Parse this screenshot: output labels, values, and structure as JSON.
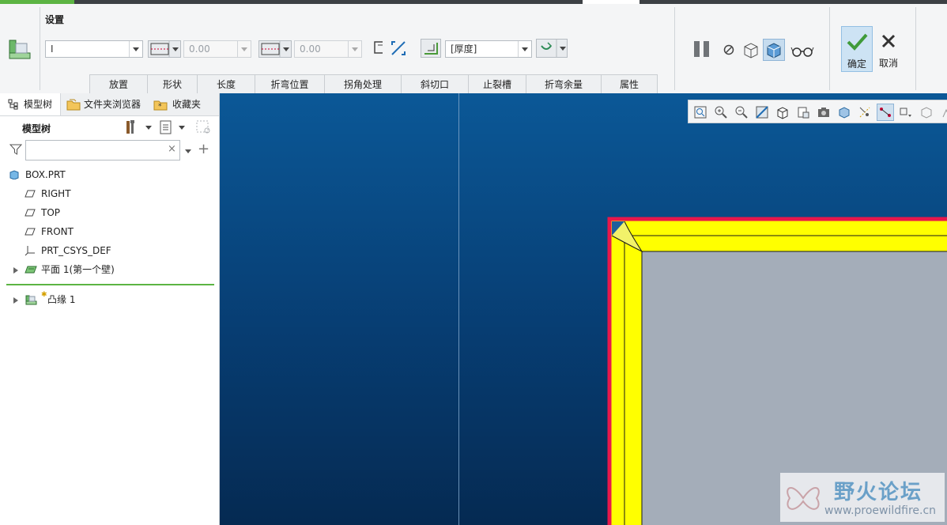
{
  "ribbon": {
    "section_label": "设置",
    "type_combo_value": "I",
    "length1_value": "0.00",
    "length2_value": "0.00",
    "thickness_combo_value": "[厚度]",
    "ok_label": "确定",
    "cancel_label": "取消",
    "tabs": [
      "放置",
      "形状",
      "长度",
      "折弯位置",
      "拐角处理",
      "斜切口",
      "止裂槽",
      "折弯余量",
      "属性"
    ]
  },
  "left_panel": {
    "tabs": {
      "model_tree": "模型树",
      "folder_browser": "文件夹浏览器",
      "favorites": "收藏夹"
    },
    "header_label": "模型树",
    "search_placeholder": "",
    "items": [
      {
        "label": "BOX.PRT",
        "icon": "part-icon"
      },
      {
        "label": "RIGHT",
        "icon": "datum-plane-icon"
      },
      {
        "label": "TOP",
        "icon": "datum-plane-icon"
      },
      {
        "label": "FRONT",
        "icon": "datum-plane-icon"
      },
      {
        "label": "PRT_CSYS_DEF",
        "icon": "csys-icon"
      },
      {
        "label": "平面 1(第一个壁)",
        "icon": "sheetmetal-wall-icon"
      },
      {
        "label": "凸缘 1",
        "icon": "flange-icon"
      }
    ]
  },
  "watermark": {
    "title": "野火论坛",
    "url": "www.proewildfire.cn"
  },
  "colors": {
    "viewport_top": "#0b5897",
    "viewport_bottom": "#052a52",
    "flange": "#ffff00",
    "edge": "#e8174a",
    "face": "#a4adb9",
    "accent_green": "#5cb443"
  }
}
